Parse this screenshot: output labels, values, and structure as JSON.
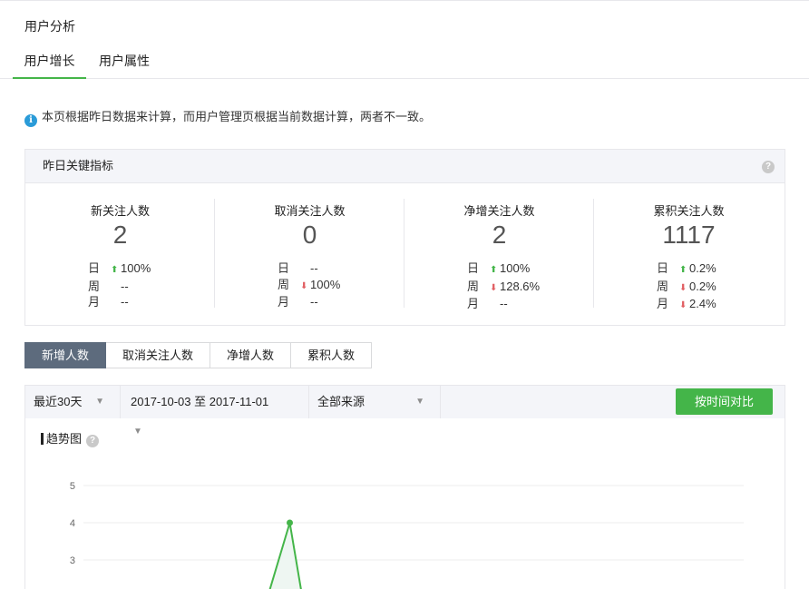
{
  "page": {
    "title": "用户分析"
  },
  "tabs": [
    {
      "label": "用户增长",
      "active": true
    },
    {
      "label": "用户属性",
      "active": false
    }
  ],
  "notice": {
    "icon": "info-icon",
    "text": "本页根据昨日数据来计算，而用户管理页根据当前数据计算，两者不一致。"
  },
  "kpi": {
    "title": "昨日关键指标",
    "columns": [
      {
        "label": "新关注人数",
        "value": "2",
        "rows": [
          {
            "period": "日",
            "dir": "up",
            "text": "100%"
          },
          {
            "period": "周",
            "dir": "",
            "text": "--"
          },
          {
            "period": "月",
            "dir": "",
            "text": "--"
          }
        ]
      },
      {
        "label": "取消关注人数",
        "value": "0",
        "rows": [
          {
            "period": "日",
            "dir": "",
            "text": "--"
          },
          {
            "period": "周",
            "dir": "down",
            "text": "100%"
          },
          {
            "period": "月",
            "dir": "",
            "text": "--"
          }
        ]
      },
      {
        "label": "净增关注人数",
        "value": "2",
        "rows": [
          {
            "period": "日",
            "dir": "up",
            "text": "100%"
          },
          {
            "period": "周",
            "dir": "down",
            "text": "128.6%"
          },
          {
            "period": "月",
            "dir": "",
            "text": "--"
          }
        ]
      },
      {
        "label": "累积关注人数",
        "value": "1117",
        "rows": [
          {
            "period": "日",
            "dir": "up",
            "text": "0.2%"
          },
          {
            "period": "周",
            "dir": "down",
            "text": "0.2%"
          },
          {
            "period": "月",
            "dir": "down",
            "text": "2.4%"
          }
        ]
      }
    ]
  },
  "segments": [
    {
      "label": "新增人数",
      "active": true
    },
    {
      "label": "取消关注人数",
      "active": false
    },
    {
      "label": "净增人数",
      "active": false
    },
    {
      "label": "累积人数",
      "active": false
    }
  ],
  "filters": {
    "range": "最近30天",
    "date_range": "2017-10-03 至 2017-11-01",
    "source": "全部来源",
    "compare_button": "按时间对比"
  },
  "trend": {
    "title": "趋势图"
  },
  "colors": {
    "accent": "#44b549",
    "down": "#e15f63",
    "segment_active": "#5d6b7d"
  },
  "chart_data": {
    "type": "line",
    "y_ticks": [
      5,
      4,
      3
    ],
    "ylim": [
      0,
      5
    ],
    "visible_points": [
      {
        "index": 9,
        "y": 4
      }
    ],
    "grid": true
  }
}
